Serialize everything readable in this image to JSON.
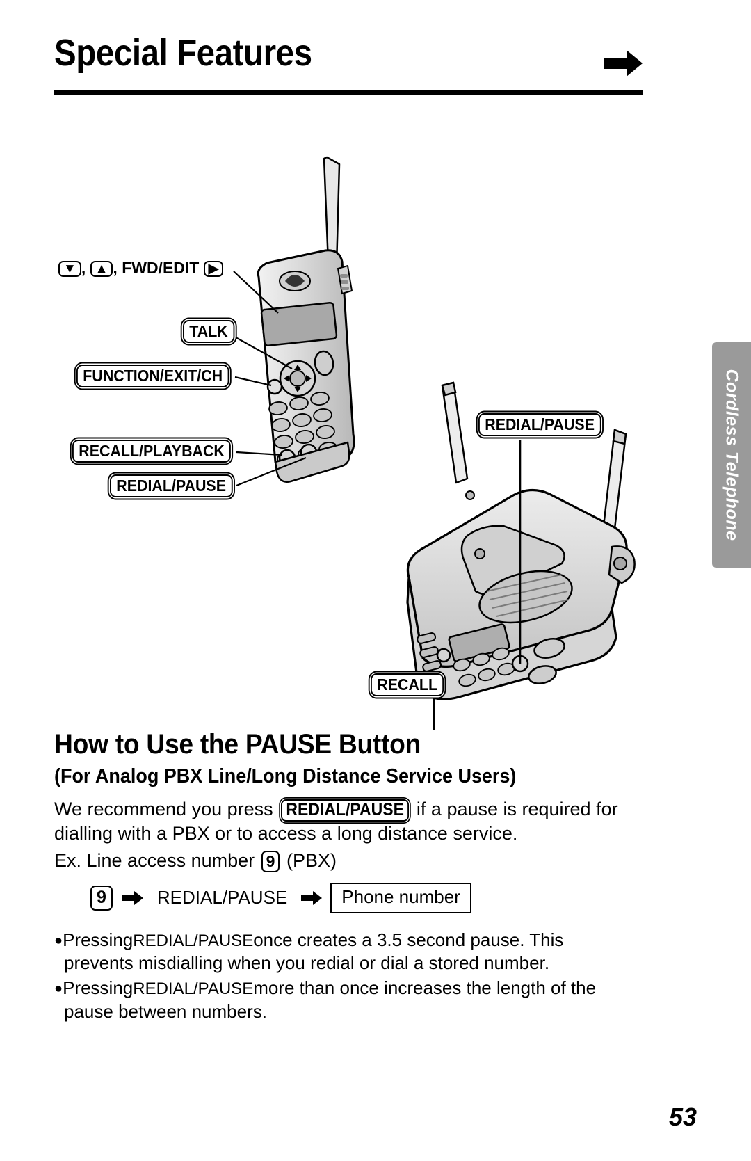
{
  "header": {
    "title": "Special Features",
    "arrow_icon": "right-arrow-icon"
  },
  "side_tab": {
    "label": "Cordless Telephone",
    "background_color": "#9a9a9a",
    "text_color": "#ffffff"
  },
  "diagram": {
    "handset_callouts": [
      {
        "id": "nav-keys",
        "prefix_keys": [
          "▼",
          "▲"
        ],
        "text": "FWD/EDIT",
        "suffix_key": "▶",
        "full_label": "▼ , ▲ , FWD/EDIT ▶"
      },
      {
        "id": "talk",
        "label": "TALK"
      },
      {
        "id": "function-exit-ch",
        "label": "FUNCTION/EXIT/CH"
      },
      {
        "id": "recall-playback",
        "label": "RECALL/PLAYBACK"
      },
      {
        "id": "redial-pause-handset",
        "label": "REDIAL/PAUSE"
      }
    ],
    "base_callouts": [
      {
        "id": "redial-pause-base",
        "label": "REDIAL/PAUSE"
      },
      {
        "id": "recall-base",
        "label": "RECALL"
      }
    ]
  },
  "content": {
    "heading": "How to Use the PAUSE Button",
    "subheading": "(For Analog PBX Line/Long Distance Service Users)",
    "paragraph": {
      "before": "We recommend you press",
      "key": "REDIAL/PAUSE",
      "after": "if a pause is required for dialling with a PBX or to access a long distance service."
    },
    "example": {
      "prefix": "Ex.  Line access number",
      "key": "9",
      "suffix": "(PBX)"
    },
    "flow": {
      "step1": "9",
      "step2": "REDIAL/PAUSE",
      "step3": "Phone number"
    },
    "bullets": [
      {
        "before": "Pressing",
        "key": "REDIAL/PAUSE",
        "after": "once creates a 3.5 second pause. This prevents misdialling when you redial or dial a stored number."
      },
      {
        "before": "Pressing",
        "key": "REDIAL/PAUSE",
        "after": "more than once increases the length of the pause between numbers."
      }
    ]
  },
  "page_number": "53"
}
